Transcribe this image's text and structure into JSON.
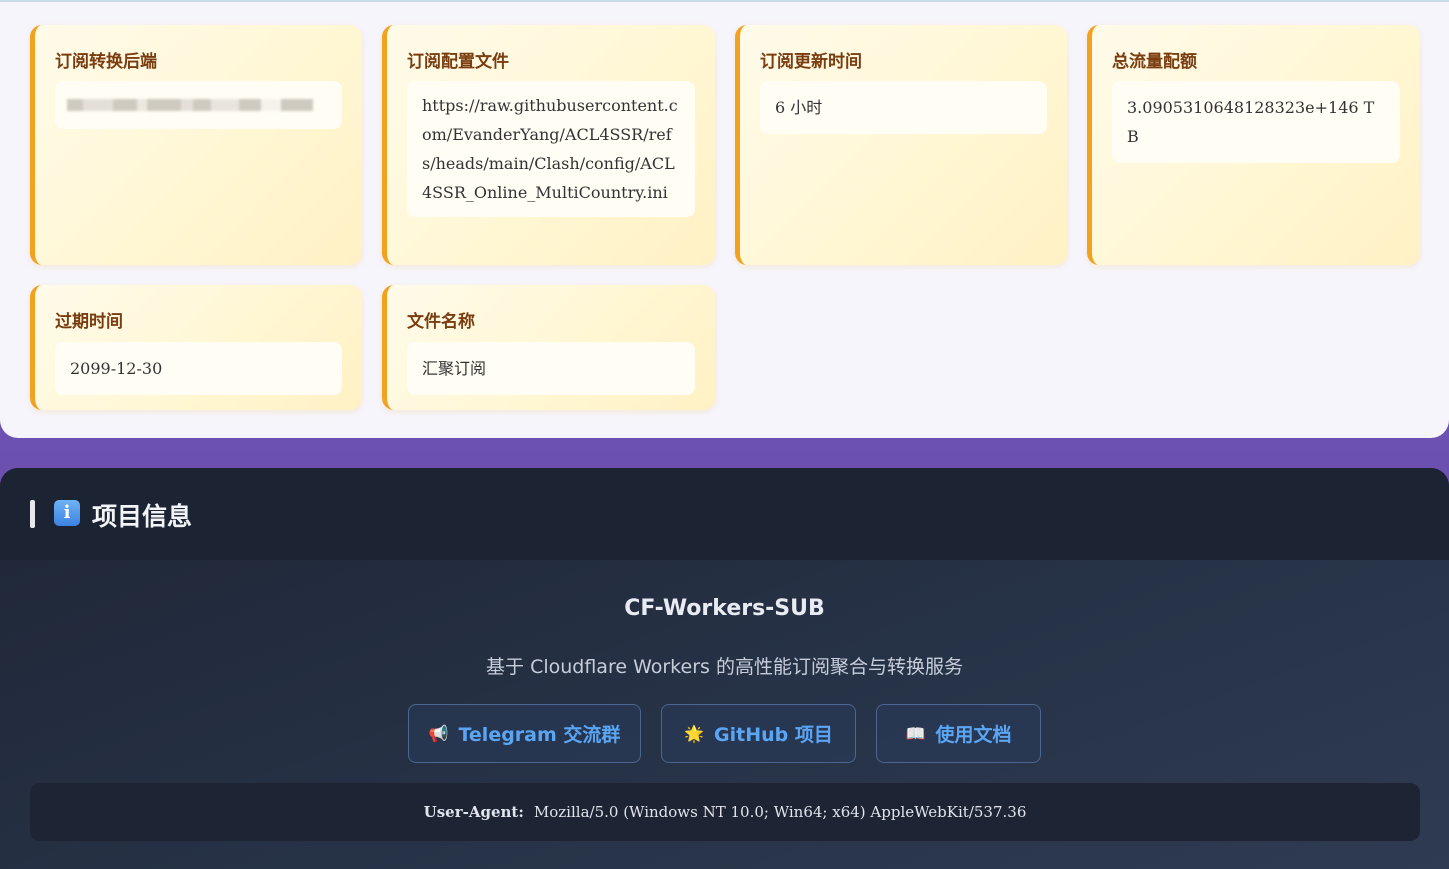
{
  "config_cards": [
    {
      "title": "订阅转换后端",
      "value": ""
    },
    {
      "title": "订阅配置文件",
      "value": "https://raw.githubusercontent.com/EvanderYang/ACL4SSR/refs/heads/main/Clash/config/ACL4SSR_Online_MultiCountry.ini"
    },
    {
      "title": "订阅更新时间",
      "value": "6 小时"
    },
    {
      "title": "总流量配额",
      "value": "3.0905310648128323e+146 TB"
    },
    {
      "title": "过期时间",
      "value": "2099-12-30"
    },
    {
      "title": "文件名称",
      "value": "汇聚订阅"
    }
  ],
  "project_info": {
    "header_title": "项目信息",
    "header_icon": "info-icon",
    "name": "CF-Workers-SUB",
    "description": "基于 Cloudflare Workers 的高性能订阅聚合与转换服务",
    "buttons": [
      {
        "icon": "megaphone-icon",
        "glyph": "📢",
        "label": "Telegram 交流群"
      },
      {
        "icon": "sun-icon",
        "glyph": "🌟",
        "label": "GitHub 项目"
      },
      {
        "icon": "book-icon",
        "glyph": "📖",
        "label": "使用文档"
      }
    ],
    "user_agent_label": "User-Agent:",
    "user_agent_value": "Mozilla/5.0 (Windows NT 10.0; Win64; x64) AppleWebKit/537.36"
  },
  "colors": {
    "card_accent": "#f3a21f",
    "card_title": "#7a3d10",
    "link_blue": "#5aa6f5",
    "dark_panel": "#1f2636"
  }
}
